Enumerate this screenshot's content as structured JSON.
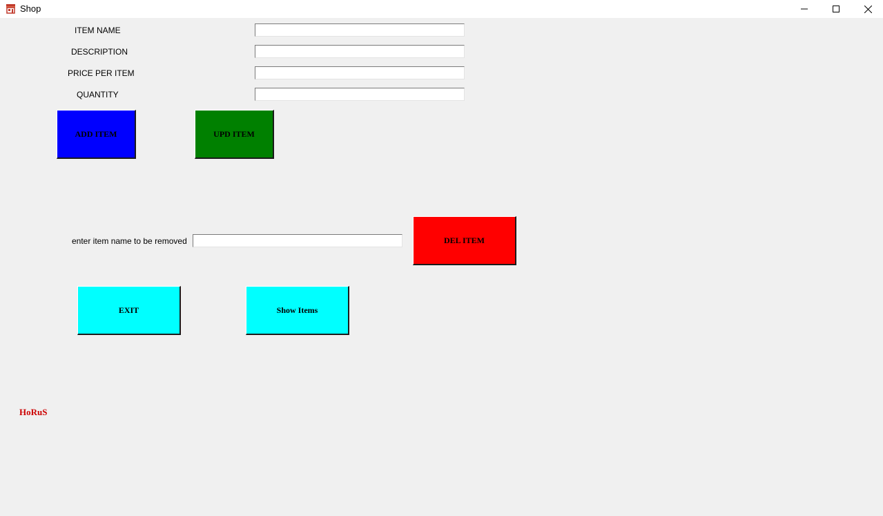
{
  "window": {
    "title": "Shop",
    "icons": {
      "app": "shop-icon",
      "minimize": "minimize-icon",
      "maximize": "maximize-icon",
      "close": "close-icon"
    }
  },
  "form": {
    "item_name_label": "ITEM NAME",
    "item_name_value": "",
    "description_label": "DESCRIPTION",
    "description_value": "",
    "price_label": "PRICE PER ITEM",
    "price_value": "",
    "quantity_label": "QUANTITY",
    "quantity_value": ""
  },
  "buttons": {
    "add_label": "ADD ITEM",
    "add_color": "#0000ff",
    "update_label": "UPD ITEM",
    "update_color": "#008000",
    "delete_label": "DEL ITEM",
    "delete_color": "#ff0000",
    "exit_label": "EXIT",
    "exit_color": "#00ffff",
    "show_label": "Show Items",
    "show_color": "#00ffff"
  },
  "remove": {
    "label": "enter item name to be removed",
    "value": ""
  },
  "footer": {
    "signature": "HoRuS",
    "signature_color": "#cc0000"
  },
  "colors": {
    "window_bg": "#f0f0f0",
    "titlebar_bg": "#ffffff",
    "app_icon": "#c0392b"
  }
}
